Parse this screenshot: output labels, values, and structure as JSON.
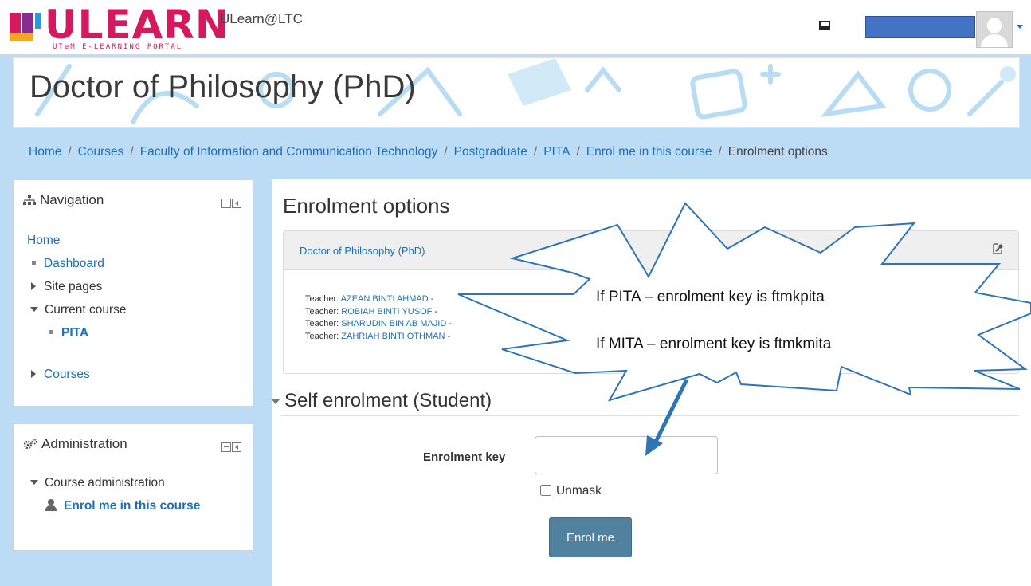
{
  "brand": {
    "logo_text": "ULEARN",
    "logo_subtitle": "UTeM E-LEARNING PORTAL",
    "site_name": "ULearn@LTC",
    "brand_color": "#d4195e"
  },
  "header": {
    "page_title": "Doctor of Philosophy (PhD)"
  },
  "breadcrumb": [
    "Home",
    "Courses",
    "Faculty of Information and Communication Technology",
    "Postgraduate",
    "PITA",
    "Enrol me in this course",
    "Enrolment options"
  ],
  "navigation": {
    "title": "Navigation",
    "items": [
      {
        "label": "Home"
      },
      {
        "label": "Dashboard"
      },
      {
        "label": "Site pages"
      },
      {
        "label": "Current course"
      },
      {
        "label": "PITA"
      },
      {
        "label": "Courses"
      }
    ]
  },
  "administration": {
    "title": "Administration",
    "items": [
      {
        "label": "Course administration"
      },
      {
        "label": "Enrol me in this course"
      }
    ]
  },
  "main": {
    "section_title": "Enrolment options",
    "course_name": "Doctor of Philosophy (PhD)",
    "teachers": [
      {
        "role": "Teacher:",
        "name": "AZEAN BINTI AHMAD",
        "suffix": "-"
      },
      {
        "role": "Teacher:",
        "name": "ROBIAH BINTI YUSOF",
        "suffix": "-"
      },
      {
        "role": "Teacher:",
        "name": "SHARUDIN BIN AB MAJID",
        "suffix": "-"
      },
      {
        "role": "Teacher:",
        "name": "ZAHRIAH BINTI OTHMAN",
        "suffix": "-"
      }
    ],
    "self_enrolment_title": "Self enrolment (Student)",
    "enrolment_key_label": "Enrolment key",
    "enrolment_key_value": "",
    "unmask_label": "Unmask",
    "enrol_button": "Enrol me"
  },
  "annotation": {
    "line1": "If PITA – enrolment key is ftmkpita",
    "line2": "If MITA – enrolment key is ftmkmita",
    "arrow_color": "#2e75b6"
  }
}
